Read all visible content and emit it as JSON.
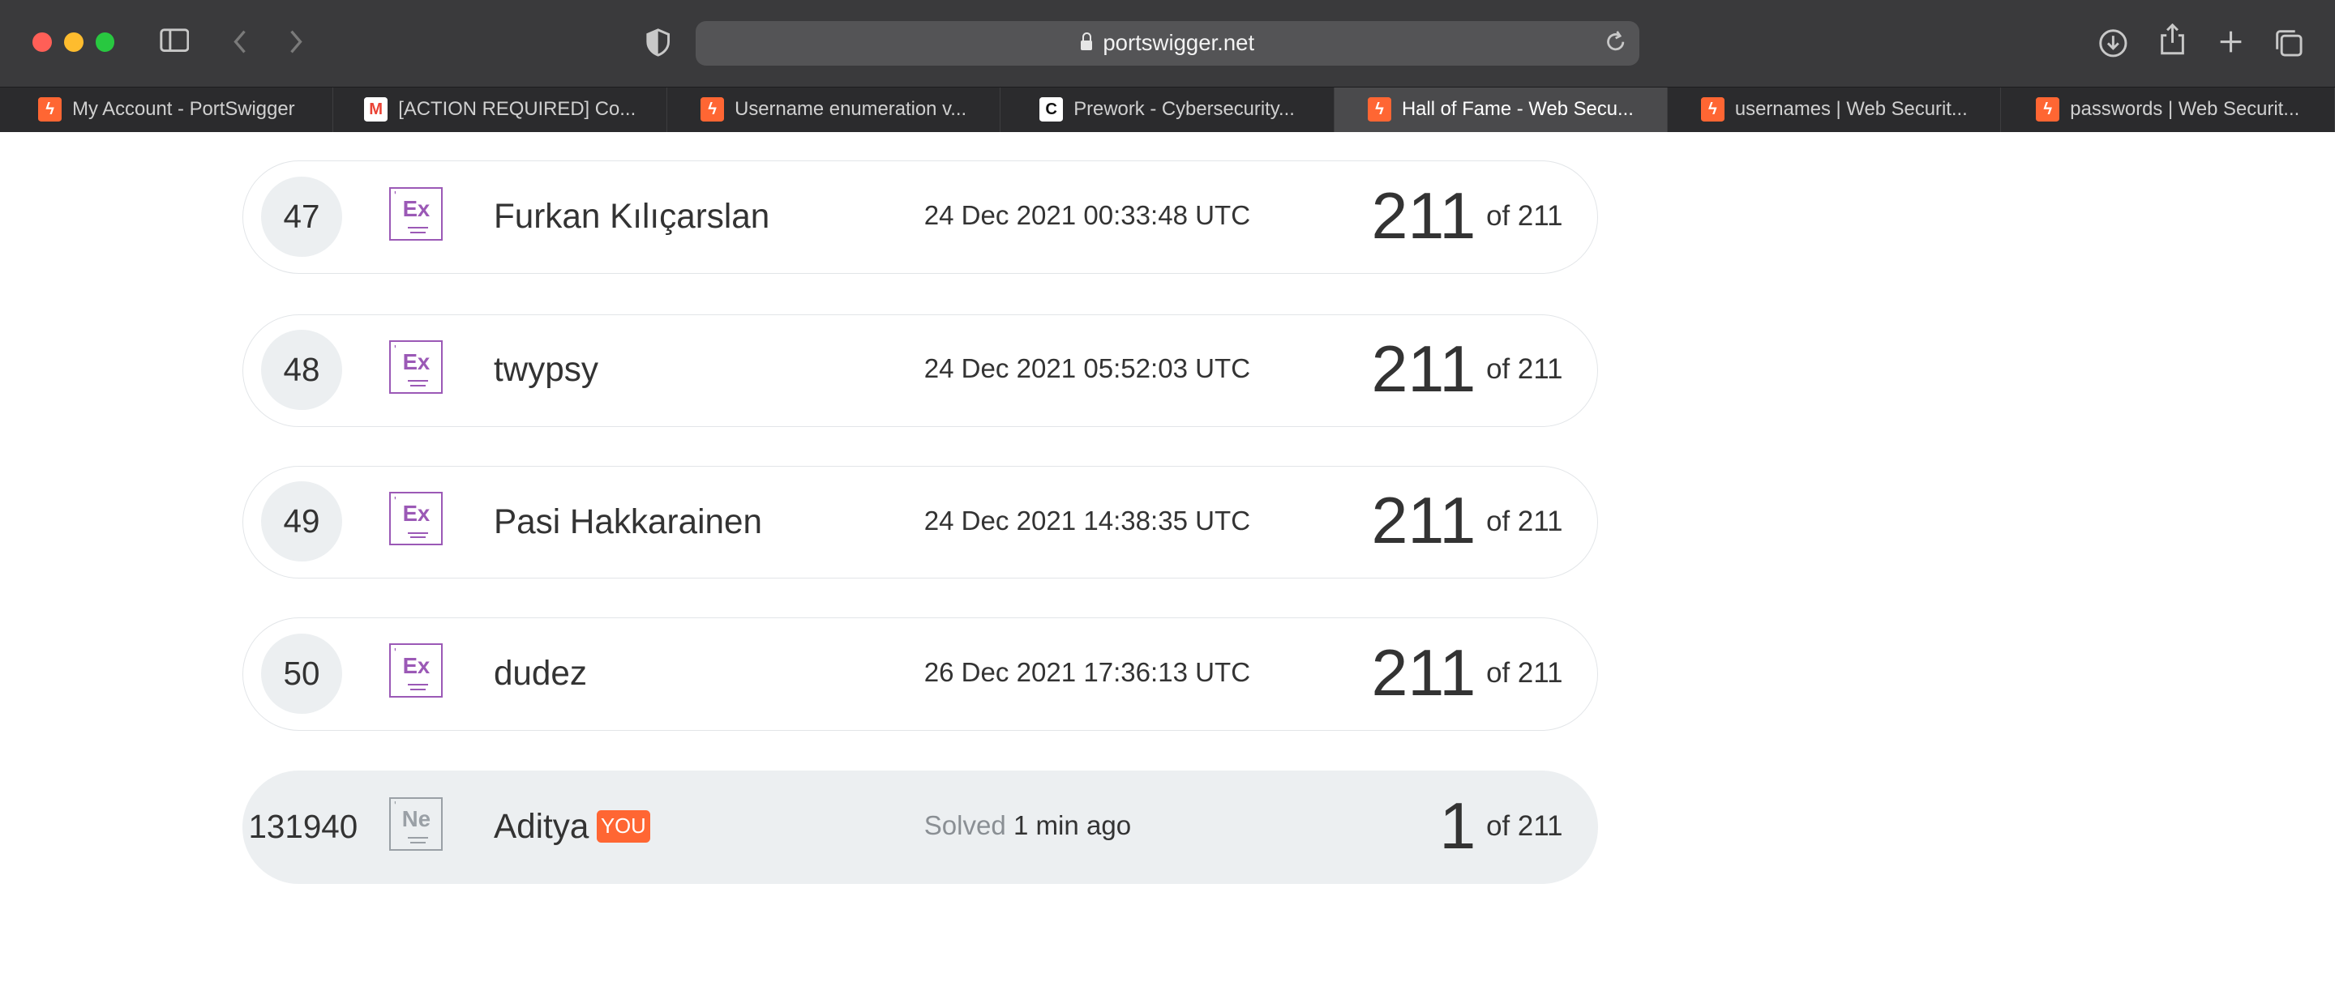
{
  "browser": {
    "url": "portswigger.net",
    "tabs": [
      {
        "label": "My Account - PortSwigger",
        "favicon": "portswigger-icon"
      },
      {
        "label": "[ACTION REQUIRED] Co...",
        "favicon": "gmail-icon"
      },
      {
        "label": "Username enumeration v...",
        "favicon": "portswigger-icon"
      },
      {
        "label": "Prework - Cybersecurity...",
        "favicon": "codepath-icon"
      },
      {
        "label": "Hall of Fame - Web Secu...",
        "favicon": "portswigger-icon",
        "active": true
      },
      {
        "label": "usernames | Web Securit...",
        "favicon": "portswigger-icon"
      },
      {
        "label": "passwords | Web Securit...",
        "favicon": "portswigger-icon"
      }
    ]
  },
  "leaderboard": {
    "rows": [
      {
        "rank": "47",
        "level": "Ex",
        "name": "Furkan Kılıçarslan",
        "when": "24 Dec 2021 00:33:48 UTC",
        "score": "211",
        "of": "of 211"
      },
      {
        "rank": "48",
        "level": "Ex",
        "name": "twypsy",
        "when": "24 Dec 2021 05:52:03 UTC",
        "score": "211",
        "of": "of 211"
      },
      {
        "rank": "49",
        "level": "Ex",
        "name": "Pasi Hakkarainen",
        "when": "24 Dec 2021 14:38:35 UTC",
        "score": "211",
        "of": "of 211"
      },
      {
        "rank": "50",
        "level": "Ex",
        "name": "dudez",
        "when": "26 Dec 2021 17:36:13 UTC",
        "score": "211",
        "of": "of 211"
      }
    ],
    "you": {
      "rank": "131940",
      "level": "Ne",
      "name": "Aditya",
      "badge": "YOU",
      "solved_label": "Solved",
      "when": "1 min ago",
      "score": "1",
      "of": "of 211"
    }
  },
  "colors": {
    "expert": "#9b59b6",
    "newbie": "#9aa0a6",
    "brand": "#ff6633"
  }
}
